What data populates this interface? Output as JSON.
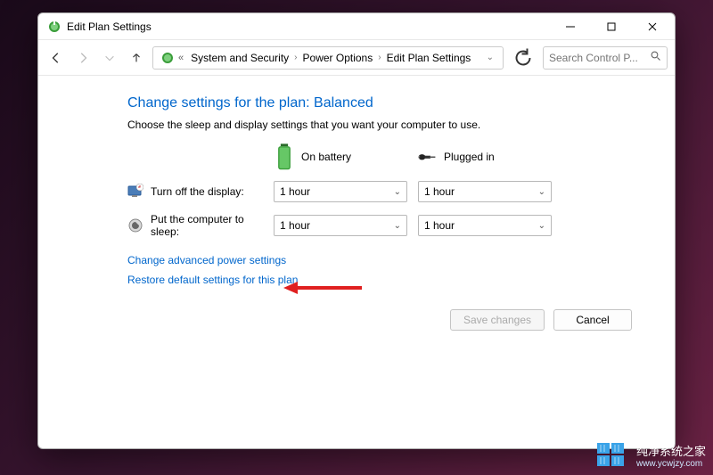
{
  "window": {
    "title": "Edit Plan Settings"
  },
  "breadcrumb": {
    "items": [
      "System and Security",
      "Power Options",
      "Edit Plan Settings"
    ]
  },
  "search": {
    "placeholder": "Search Control P..."
  },
  "page": {
    "heading": "Change settings for the plan: Balanced",
    "subtext": "Choose the sleep and display settings that you want your computer to use."
  },
  "columns": {
    "battery": "On battery",
    "plugged": "Plugged in"
  },
  "settings": {
    "display": {
      "label": "Turn off the display:",
      "battery": "1 hour",
      "plugged": "1 hour"
    },
    "sleep": {
      "label": "Put the computer to sleep:",
      "battery": "1 hour",
      "plugged": "1 hour"
    }
  },
  "links": {
    "advanced": "Change advanced power settings",
    "restore": "Restore default settings for this plan"
  },
  "buttons": {
    "save": "Save changes",
    "cancel": "Cancel"
  },
  "watermark": {
    "name": "纯净系统之家",
    "url": "www.ycwjzy.com"
  }
}
